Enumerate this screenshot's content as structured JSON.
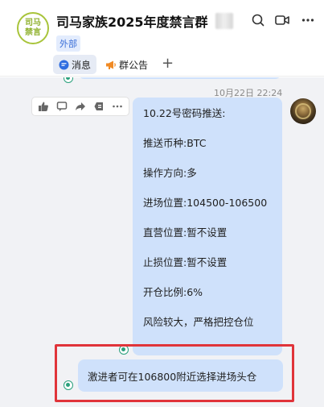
{
  "header": {
    "avatar_line1": "司马",
    "avatar_line2": "禁言",
    "title": "司马家族2025年度禁言群",
    "tag": "外部",
    "tabs": [
      {
        "label": "消息",
        "active": true
      },
      {
        "label": "群公告",
        "active": false
      }
    ]
  },
  "chat": {
    "timestamp": "10月22日 22:24",
    "message_lines": [
      "10.22号密码推送:",
      "推送币种:BTC",
      "操作方向:多",
      "进场位置:104500-106500",
      "直营位置:暂不设置",
      "止损位置:暂不设置",
      "开仓比例:6%",
      "风险较大，严格把控仓位"
    ],
    "second_message": "激进者可在106800附近选择进场头仓"
  },
  "colors": {
    "accent": "#3b6fd8",
    "bubble": "#cfe1fb",
    "read_mark": "#2aa07c",
    "highlight": "#e0343a"
  }
}
